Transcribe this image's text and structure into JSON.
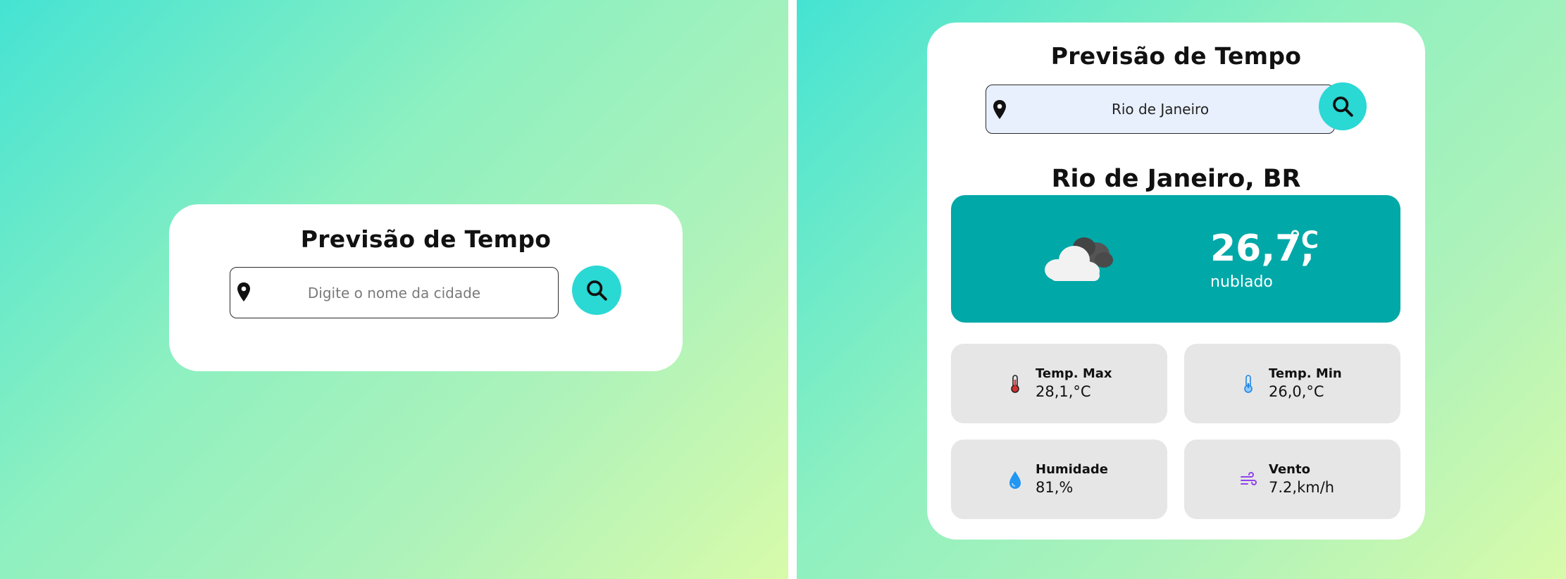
{
  "app_title": "Previsão de Tempo",
  "left": {
    "search": {
      "placeholder": "Digite o nome da cidade"
    }
  },
  "right": {
    "search": {
      "value": "Rio de Janeiro"
    },
    "city": "Rio de Janeiro, BR",
    "weather": {
      "temperature": "26,7,",
      "unit": "°C",
      "condition": "nublado",
      "icon": "cloud-icon"
    },
    "stats": {
      "max": {
        "label": "Temp. Max",
        "value": "28,1,°C",
        "icon": "thermometer-hot-icon"
      },
      "min": {
        "label": "Temp. Min",
        "value": "26,0,°C",
        "icon": "thermometer-cold-icon"
      },
      "humidity": {
        "label": "Humidade",
        "value": "81,%",
        "icon": "water-drop-icon"
      },
      "wind": {
        "label": "Vento",
        "value": "7.2,km/h",
        "icon": "wind-icon"
      }
    }
  },
  "colors": {
    "accent": "#2ad8d4",
    "weather_box": "#00a8a8",
    "stat_card": "#e6e6e6",
    "thermo_hot": "#d32f2f",
    "thermo_cold": "#1e88e5",
    "drop": "#2196f3",
    "wind": "#8e44ec"
  }
}
